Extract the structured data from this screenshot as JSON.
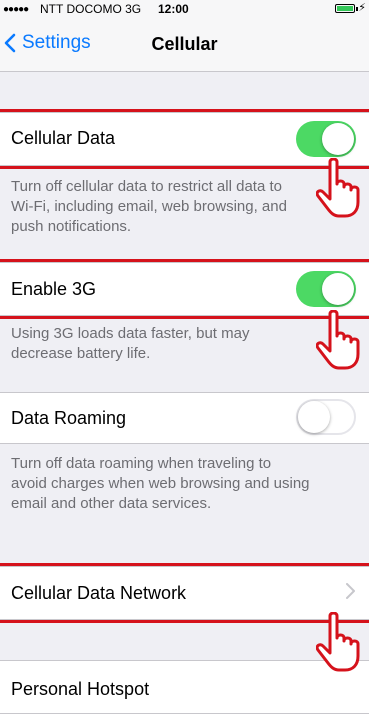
{
  "status_bar": {
    "signal": "●●●●●",
    "carrier": "NTT DOCOMO  3G",
    "time": "12:00",
    "battery_charging_icon": "bolt-icon"
  },
  "nav": {
    "back_label": "Settings",
    "title": "Cellular"
  },
  "settings": [
    {
      "label": "Cellular Data",
      "toggle": true,
      "footer_lines": [
        "Turn off cellular data to restrict all data to",
        "Wi-Fi, including email, web browsing, and",
        "push notifications."
      ]
    },
    {
      "label": "Enable 3G",
      "toggle": true,
      "footer_lines": [
        "Using 3G loads data faster, but may",
        "decrease battery life."
      ]
    },
    {
      "label": "Data Roaming",
      "toggle": false,
      "footer_lines": [
        "Turn off data roaming when traveling to",
        "avoid charges when web browsing and using",
        "email and other data services."
      ]
    },
    {
      "label": "Cellular Data Network"
    },
    {
      "label": "Personal Hotspot"
    }
  ],
  "colors": {
    "accent": "#0a7aff",
    "switch_on": "#4cd964",
    "highlight": "#d5121b"
  }
}
